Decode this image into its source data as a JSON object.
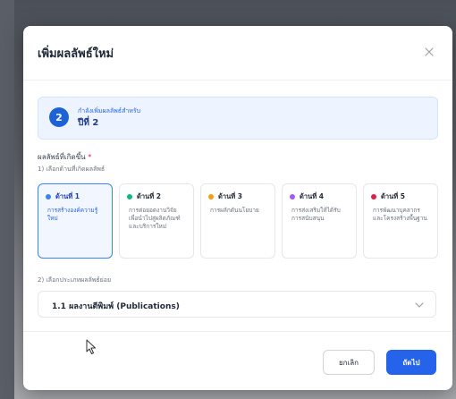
{
  "modal": {
    "title": "เพิ่มผลลัพธ์ใหม่"
  },
  "info": {
    "step_number": "2",
    "caption": "กำลังเพิ่มผลลัพธ์สำหรับ",
    "year": "ปีที่ 2"
  },
  "field": {
    "label": "ผลลัพธ์ที่เกิดขึ้น",
    "required_mark": "*",
    "step1_label": "1) เลือกด้านที่เกิดผลลัพธ์",
    "step2_label": "2) เลือกประเภทผลลัพธ์ย่อย"
  },
  "categories": [
    {
      "title": "ด้านที่ 1",
      "desc": "การสร้างองค์ความรู้ใหม่",
      "color": "#3b82f6",
      "selected": true
    },
    {
      "title": "ด้านที่ 2",
      "desc": "การต่อยอดงานวิจัยเพื่อนำไปสู่ผลิตภัณฑ์และบริการใหม่",
      "color": "#10b981",
      "selected": false
    },
    {
      "title": "ด้านที่ 3",
      "desc": "การผลักดันนโยบาย",
      "color": "#f59e0b",
      "selected": false
    },
    {
      "title": "ด้านที่ 4",
      "desc": "การส่งเสริมให้ได้รับการสนับสนุน",
      "color": "#a855f7",
      "selected": false
    },
    {
      "title": "ด้านที่ 5",
      "desc": "การพัฒนาบุคลากรและโครงสร้างพื้นฐาน",
      "color": "#e11d48",
      "selected": false
    }
  ],
  "subtype": {
    "selected_value": "1.1 ผลงานตีพิมพ์ (Publications)"
  },
  "footer": {
    "cancel_label": "ยกเลิก",
    "next_label": "ถัดไป"
  },
  "icons": {
    "close": "close-icon",
    "chevron": "chevron-down-icon",
    "cursor": "mouse-cursor-icon"
  }
}
